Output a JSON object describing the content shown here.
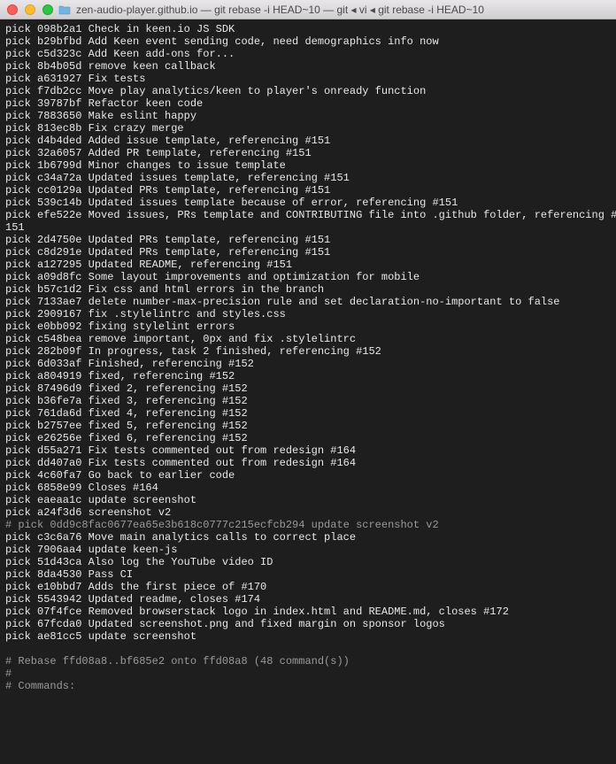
{
  "window": {
    "title": "zen-audio-player.github.io — git rebase -i HEAD~10 — git ◂ vi ◂ git rebase -i HEAD~10"
  },
  "rebase": {
    "commits": [
      {
        "cmd": "pick",
        "hash": "098b2a1",
        "msg": "Check in keen.io JS SDK"
      },
      {
        "cmd": "pick",
        "hash": "b29bfbd",
        "msg": "Add Keen event sending code, need demographics info now"
      },
      {
        "cmd": "pick",
        "hash": "c5d323c",
        "msg": "Add Keen add-ons for..."
      },
      {
        "cmd": "pick",
        "hash": "8b4b05d",
        "msg": "remove keen callback"
      },
      {
        "cmd": "pick",
        "hash": "a631927",
        "msg": "Fix tests"
      },
      {
        "cmd": "pick",
        "hash": "f7db2cc",
        "msg": "Move play analytics/keen to player's onready function"
      },
      {
        "cmd": "pick",
        "hash": "39787bf",
        "msg": "Refactor keen code"
      },
      {
        "cmd": "pick",
        "hash": "7883650",
        "msg": "Make eslint happy"
      },
      {
        "cmd": "pick",
        "hash": "813ec8b",
        "msg": "Fix crazy merge"
      },
      {
        "cmd": "pick",
        "hash": "d4b4ded",
        "msg": "Added issue template, referencing #151"
      },
      {
        "cmd": "pick",
        "hash": "32a6057",
        "msg": "Added PR template, referencing #151"
      },
      {
        "cmd": "pick",
        "hash": "1b6799d",
        "msg": "Minor changes to issue template"
      },
      {
        "cmd": "pick",
        "hash": "c34a72a",
        "msg": "Updated issues template, referencing #151"
      },
      {
        "cmd": "pick",
        "hash": "cc0129a",
        "msg": "Updated PRs template, referencing #151"
      },
      {
        "cmd": "pick",
        "hash": "539c14b",
        "msg": "Updated issues template because of error, referencing #151"
      },
      {
        "cmd": "pick",
        "hash": "efe522e",
        "msg": "Moved issues, PRs template and CONTRIBUTING file into .github folder, referencing #151"
      },
      {
        "cmd": "pick",
        "hash": "2d4750e",
        "msg": "Updated PRs template, referencing #151"
      },
      {
        "cmd": "pick",
        "hash": "c8d291e",
        "msg": "Updated PRs template, referencing #151"
      },
      {
        "cmd": "pick",
        "hash": "a127295",
        "msg": "Updated README, referencing #151"
      },
      {
        "cmd": "pick",
        "hash": "a09d8fc",
        "msg": "Some layout improvements and optimization for mobile"
      },
      {
        "cmd": "pick",
        "hash": "b57c1d2",
        "msg": "Fix css and html errors in the branch"
      },
      {
        "cmd": "pick",
        "hash": "7133ae7",
        "msg": "delete number-max-precision rule and set declaration-no-important to false"
      },
      {
        "cmd": "pick",
        "hash": "2909167",
        "msg": "fix .stylelintrc and styles.css"
      },
      {
        "cmd": "pick",
        "hash": "e0bb092",
        "msg": "fixing stylelint errors"
      },
      {
        "cmd": "pick",
        "hash": "c548bea",
        "msg": "remove important, 0px and fix .stylelintrc"
      },
      {
        "cmd": "pick",
        "hash": "282b09f",
        "msg": "In progress, task 2 finished, referencing #152"
      },
      {
        "cmd": "pick",
        "hash": "6d033af",
        "msg": "Finished, referencing #152"
      },
      {
        "cmd": "pick",
        "hash": "a804919",
        "msg": "fixed, referencing #152"
      },
      {
        "cmd": "pick",
        "hash": "87496d9",
        "msg": "fixed 2, referencing #152"
      },
      {
        "cmd": "pick",
        "hash": "b36fe7a",
        "msg": "fixed 3, referencing #152"
      },
      {
        "cmd": "pick",
        "hash": "761da6d",
        "msg": "fixed 4, referencing #152"
      },
      {
        "cmd": "pick",
        "hash": "b2757ee",
        "msg": "fixed 5, referencing #152"
      },
      {
        "cmd": "pick",
        "hash": "e26256e",
        "msg": "fixed 6, referencing #152"
      },
      {
        "cmd": "pick",
        "hash": "d55a271",
        "msg": "Fix tests commented out from redesign #164"
      },
      {
        "cmd": "pick",
        "hash": "dd407a0",
        "msg": "Fix tests commented out from redesign #164"
      },
      {
        "cmd": "pick",
        "hash": "4c60fa7",
        "msg": "Go back to earlier code"
      },
      {
        "cmd": "pick",
        "hash": "6858e99",
        "msg": "Closes #164"
      },
      {
        "cmd": "pick",
        "hash": "eaeaa1c",
        "msg": "update screenshot"
      },
      {
        "cmd": "pick",
        "hash": "a24f3d6",
        "msg": "screenshot v2"
      },
      {
        "cmd": "# pick",
        "hash": "0dd9c8fac0677ea65e3b618c0777c215ecfcb294",
        "msg": "update screenshot v2",
        "comment": true
      },
      {
        "cmd": "pick",
        "hash": "c3c6a76",
        "msg": "Move main analytics calls to correct place"
      },
      {
        "cmd": "pick",
        "hash": "7906aa4",
        "msg": "update keen-js"
      },
      {
        "cmd": "pick",
        "hash": "51d43ca",
        "msg": "Also log the YouTube video ID"
      },
      {
        "cmd": "pick",
        "hash": "8da4530",
        "msg": "Pass CI"
      },
      {
        "cmd": "pick",
        "hash": "e10bbd7",
        "msg": "Adds the first piece of #170"
      },
      {
        "cmd": "pick",
        "hash": "5543942",
        "msg": "Updated readme, closes #174"
      },
      {
        "cmd": "pick",
        "hash": "07f4fce",
        "msg": "Removed browserstack logo in index.html and README.md, closes #172"
      },
      {
        "cmd": "pick",
        "hash": "67fcda0",
        "msg": "Updated screenshot.png and fixed margin on sponsor logos"
      },
      {
        "cmd": "pick",
        "hash": "ae81cc5",
        "msg": "update screenshot"
      }
    ],
    "footer": [
      "",
      "# Rebase ffd08a8..bf685e2 onto ffd08a8 (48 command(s))",
      "#",
      "# Commands:"
    ]
  }
}
